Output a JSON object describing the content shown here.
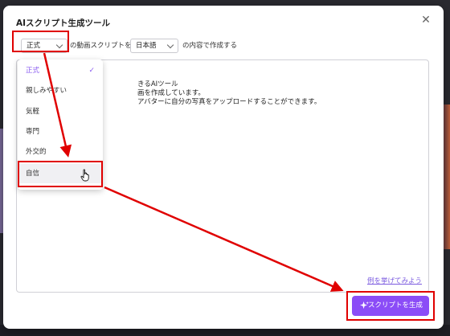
{
  "modal": {
    "title": "AIスクリプト生成ツール",
    "close_icon": "close-icon"
  },
  "controls": {
    "tone_value": "正式",
    "text_before_lang": "の動画スクリプトを",
    "lang_value": "日本語",
    "text_after_lang": "の内容で作成する"
  },
  "textarea": {
    "lines": [
      "きるAIツール",
      "画を作成しています。",
      "アバターに自分の写真をアップロードすることができます。"
    ],
    "example_link": "例を挙げてみよう"
  },
  "dropdown": {
    "items": [
      {
        "label": "正式",
        "selected": true
      },
      {
        "label": "親しみやすい",
        "selected": false
      },
      {
        "label": "気軽",
        "selected": false
      },
      {
        "label": "専門",
        "selected": false
      },
      {
        "label": "外交的",
        "selected": false
      },
      {
        "label": "自信",
        "selected": false,
        "hovered": true
      }
    ]
  },
  "generate_button": {
    "label": "スクリプトを生成",
    "icon": "sparkle-icon"
  },
  "colors": {
    "accent": "#8b4cf7",
    "annotation": "#e00000",
    "link": "#7c5ce0"
  }
}
